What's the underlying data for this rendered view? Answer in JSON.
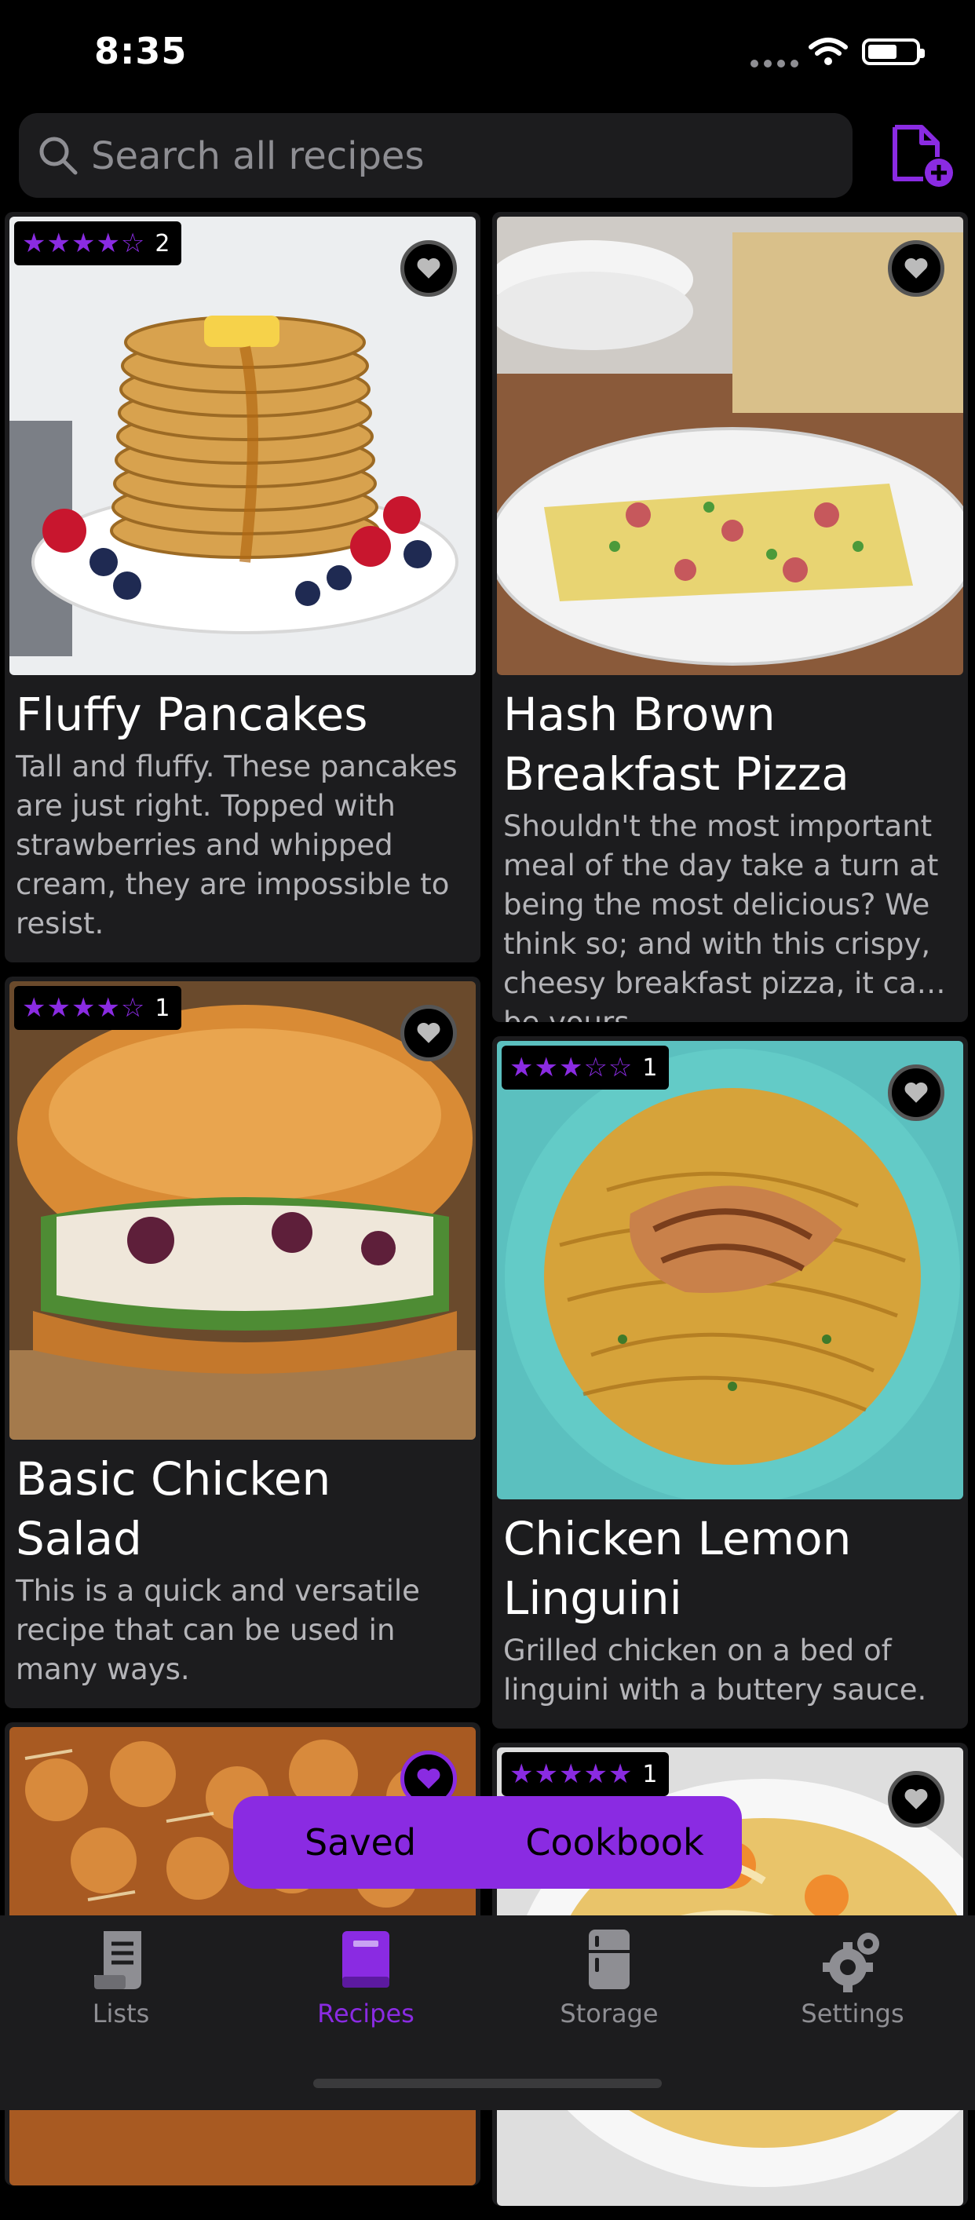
{
  "status": {
    "time": "8:35"
  },
  "search": {
    "placeholder": "Search all recipes"
  },
  "colors": {
    "accent": "#8a2be2",
    "card": "#1c1c1e",
    "background": "#000000",
    "muted_text": "#b4b4b8"
  },
  "recipes_left": [
    {
      "title": "Fluffy Pancakes",
      "description": "Tall and fluffy. These pancakes are just right. Topped with strawberries and whipped cream, they are impossible to resist.",
      "stars": "★★★★☆",
      "rating": 4.5,
      "count": "2",
      "favorite": false,
      "image": "pancakes"
    },
    {
      "title": "Basic Chicken Salad",
      "description": "This is a quick and versatile recipe that can be used in many ways.",
      "stars": "★★★★☆",
      "rating": 4,
      "count": "1",
      "favorite": false,
      "image": "chicken-salad-croissant"
    },
    {
      "title": "",
      "description": "",
      "stars": "",
      "count": "",
      "favorite": true,
      "image": "tater-tot-casserole"
    }
  ],
  "recipes_right": [
    {
      "title": "Hash Brown Breakfast Pizza",
      "description": "Shouldn't the most important meal of the day take a turn at being the most delicious? We think so; and with this crispy, cheesy breakfast pizza, it can be yours.",
      "stars": "",
      "count": "",
      "favorite": false,
      "image": "breakfast-pizza"
    },
    {
      "title": "Chicken Lemon Linguini",
      "description": "Grilled chicken on a bed of linguini with a buttery sauce.",
      "stars": "★★★☆☆",
      "rating": 3,
      "count": "1",
      "favorite": false,
      "image": "lemon-linguini"
    },
    {
      "title": "",
      "description": "",
      "stars": "★★★★★",
      "rating": 5,
      "count": "1",
      "favorite": false,
      "image": "chicken-noodle-soup"
    }
  ],
  "toggle": {
    "saved": "Saved",
    "cookbook": "Cookbook"
  },
  "tabs": [
    {
      "label": "Lists",
      "icon": "list-icon"
    },
    {
      "label": "Recipes",
      "icon": "book-icon",
      "active": true
    },
    {
      "label": "Storage",
      "icon": "fridge-icon"
    },
    {
      "label": "Settings",
      "icon": "gear-icon"
    }
  ]
}
